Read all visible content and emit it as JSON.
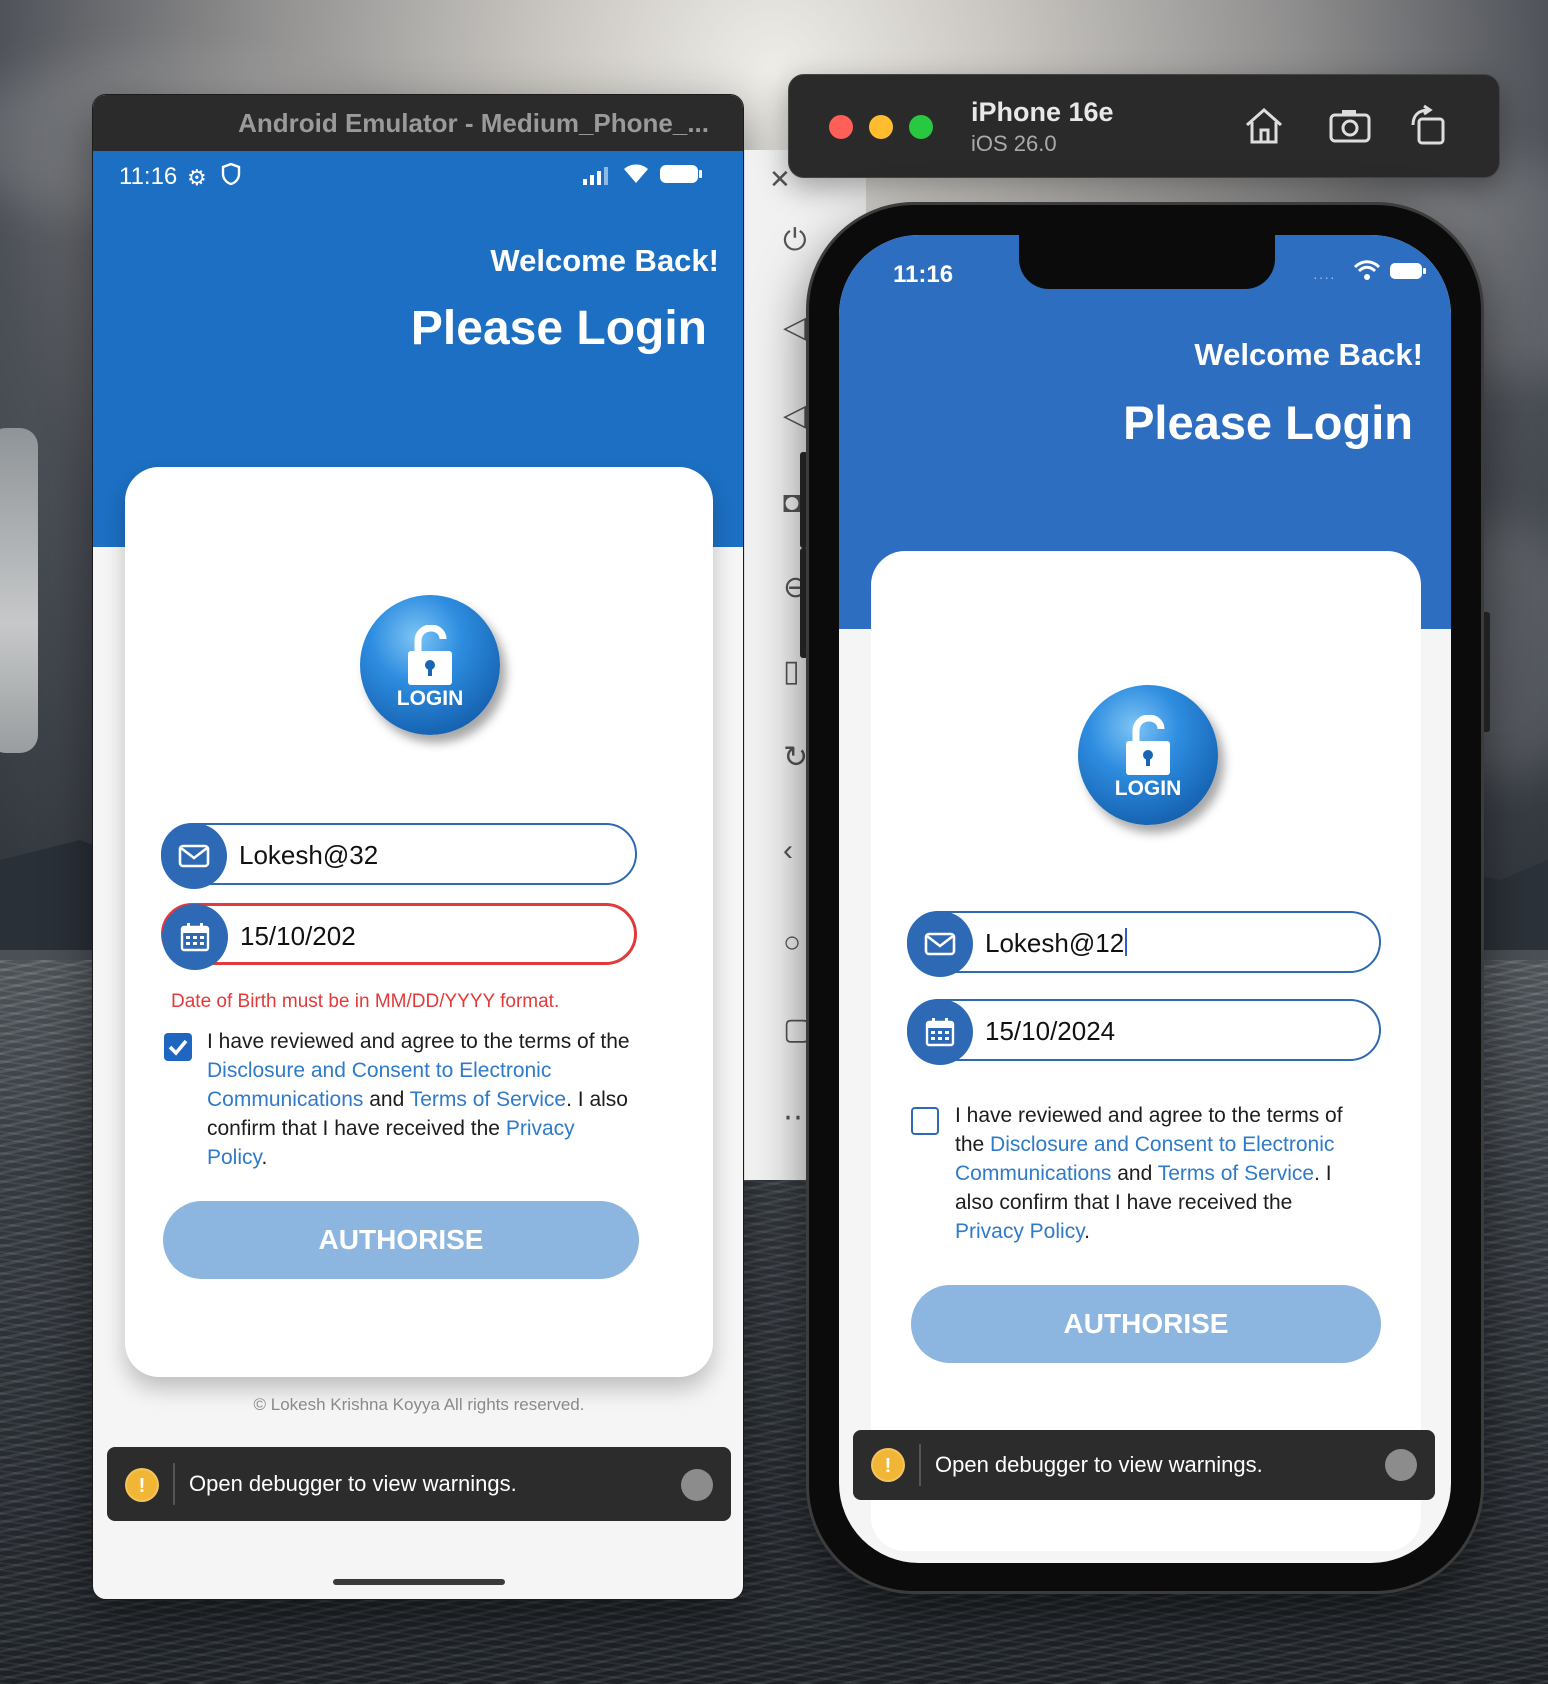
{
  "colors": {
    "android_primary": "#1c6fc2",
    "ios_primary": "#2d6ec0",
    "field_border": "#2d69b4",
    "error": "#e23a3a",
    "link": "#2f7ac9",
    "authorise_disabled": "#8cb6e0",
    "checkbox_checked": "#1f66c0"
  },
  "android": {
    "window_title": "Android Emulator - Medium_Phone_...",
    "status": {
      "time": "11:16"
    },
    "header": {
      "welcome": "Welcome Back!",
      "title": "Please Login"
    },
    "logo_text": "LOGIN",
    "username": {
      "value": "Lokesh@32"
    },
    "dob": {
      "value": "15/10/202"
    },
    "dob_error": "Date of Birth must be in MM/DD/YYYY format.",
    "terms": {
      "checked": true,
      "part1": "I have reviewed and agree to the terms of the ",
      "link1": "Disclosure and Consent to Electronic Communications",
      "part2": " and ",
      "link2": "Terms of Service",
      "part3": ". I also confirm that I have received the ",
      "link3": "Privacy Policy",
      "part4": "."
    },
    "authorise_label": "AUTHORISE",
    "footer": "© Lokesh Krishna Koyya All rights reserved.",
    "debug_warning": "Open debugger to view warnings."
  },
  "ios": {
    "device_name": "iPhone 16e",
    "os_version": "iOS 26.0",
    "status": {
      "time": "11:16"
    },
    "header": {
      "welcome": "Welcome Back!",
      "title": "Please Login"
    },
    "logo_text": "LOGIN",
    "username": {
      "value": "Lokesh@12"
    },
    "dob": {
      "value": "15/10/2024"
    },
    "terms": {
      "checked": false,
      "part1": "I have reviewed and agree to the terms of the ",
      "link1": "Disclosure and Consent to Electronic Communications",
      "part2": " and ",
      "link2": "Terms of Service",
      "part3": ". I also confirm that I have received the ",
      "link3": "Privacy Policy",
      "part4": "."
    },
    "authorise_label": "AUTHORISE",
    "debug_warning": "Open debugger to view warnings."
  },
  "icons": {
    "envelope": "envelope-icon",
    "calendar": "calendar-icon",
    "lock": "lock-icon",
    "warning": "warning-icon"
  }
}
